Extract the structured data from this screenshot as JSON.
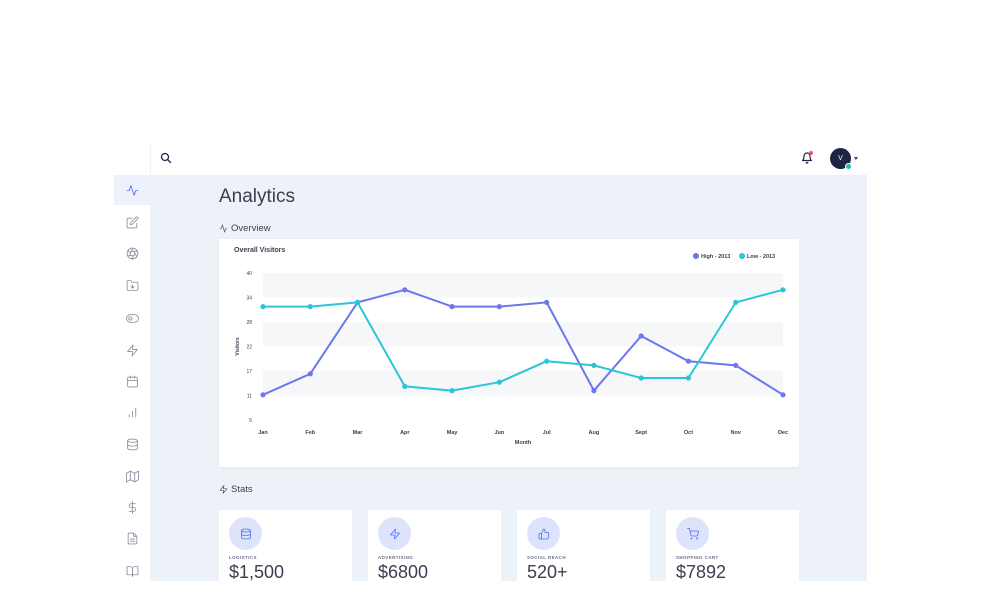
{
  "header": {
    "avatar_initial": "V",
    "search_icon": "search-icon",
    "notification_icon": "bell-icon"
  },
  "sidebar": {
    "items": [
      {
        "name": "activity",
        "icon": "activity-icon",
        "active": true
      },
      {
        "name": "edit",
        "icon": "edit-icon"
      },
      {
        "name": "aperture",
        "icon": "aperture-icon"
      },
      {
        "name": "folder",
        "icon": "folder-icon"
      },
      {
        "name": "toggle",
        "icon": "toggle-icon"
      },
      {
        "name": "zap",
        "icon": "zap-icon"
      },
      {
        "name": "calendar",
        "icon": "calendar-icon"
      },
      {
        "name": "bar-chart",
        "icon": "bar-chart-icon"
      },
      {
        "name": "database",
        "icon": "database-icon"
      },
      {
        "name": "map",
        "icon": "map-icon"
      },
      {
        "name": "dollar",
        "icon": "dollar-icon"
      },
      {
        "name": "file",
        "icon": "file-icon"
      },
      {
        "name": "book",
        "icon": "book-icon"
      }
    ]
  },
  "page": {
    "title": "Analytics",
    "overview_label": "Overview",
    "stats_label": "Stats"
  },
  "chart_data": {
    "type": "line",
    "title": "Overall Visitors",
    "xlabel": "Month",
    "ylabel": "Visitors",
    "categories": [
      "Jan",
      "Feb",
      "Mar",
      "Apr",
      "May",
      "Jun",
      "Jul",
      "Aug",
      "Sept",
      "Oct",
      "Nov",
      "Dec"
    ],
    "y_ticks": [
      "40",
      "34",
      "28",
      "22",
      "17",
      "11",
      "5"
    ],
    "ylim": [
      5,
      40
    ],
    "grid": "alternating horizontal bands",
    "legend_position": "top-right",
    "series": [
      {
        "name": "High - 2013",
        "color": "#6a78ec",
        "values": [
          11,
          16,
          33,
          36,
          32,
          32,
          33,
          12,
          25,
          19,
          18,
          11
        ]
      },
      {
        "name": "Low - 2013",
        "color": "#2bc6d6",
        "values": [
          32,
          32,
          33,
          13,
          12,
          14,
          19,
          18,
          15,
          15,
          33,
          36
        ]
      }
    ]
  },
  "stats": [
    {
      "label": "LOGISTICS",
      "value": "$1,500",
      "icon": "database-icon"
    },
    {
      "label": "ADVERTISING",
      "value": "$6800",
      "icon": "zap-icon"
    },
    {
      "label": "SOCIAL REACH",
      "value": "520+",
      "icon": "thumbs-up-icon"
    },
    {
      "label": "SHOPPING CART",
      "value": "$7892",
      "icon": "shopping-cart-icon"
    }
  ],
  "colors": {
    "accent": "#4f6ef7",
    "background": "#edf1f8",
    "avatar": "#1c2541"
  }
}
